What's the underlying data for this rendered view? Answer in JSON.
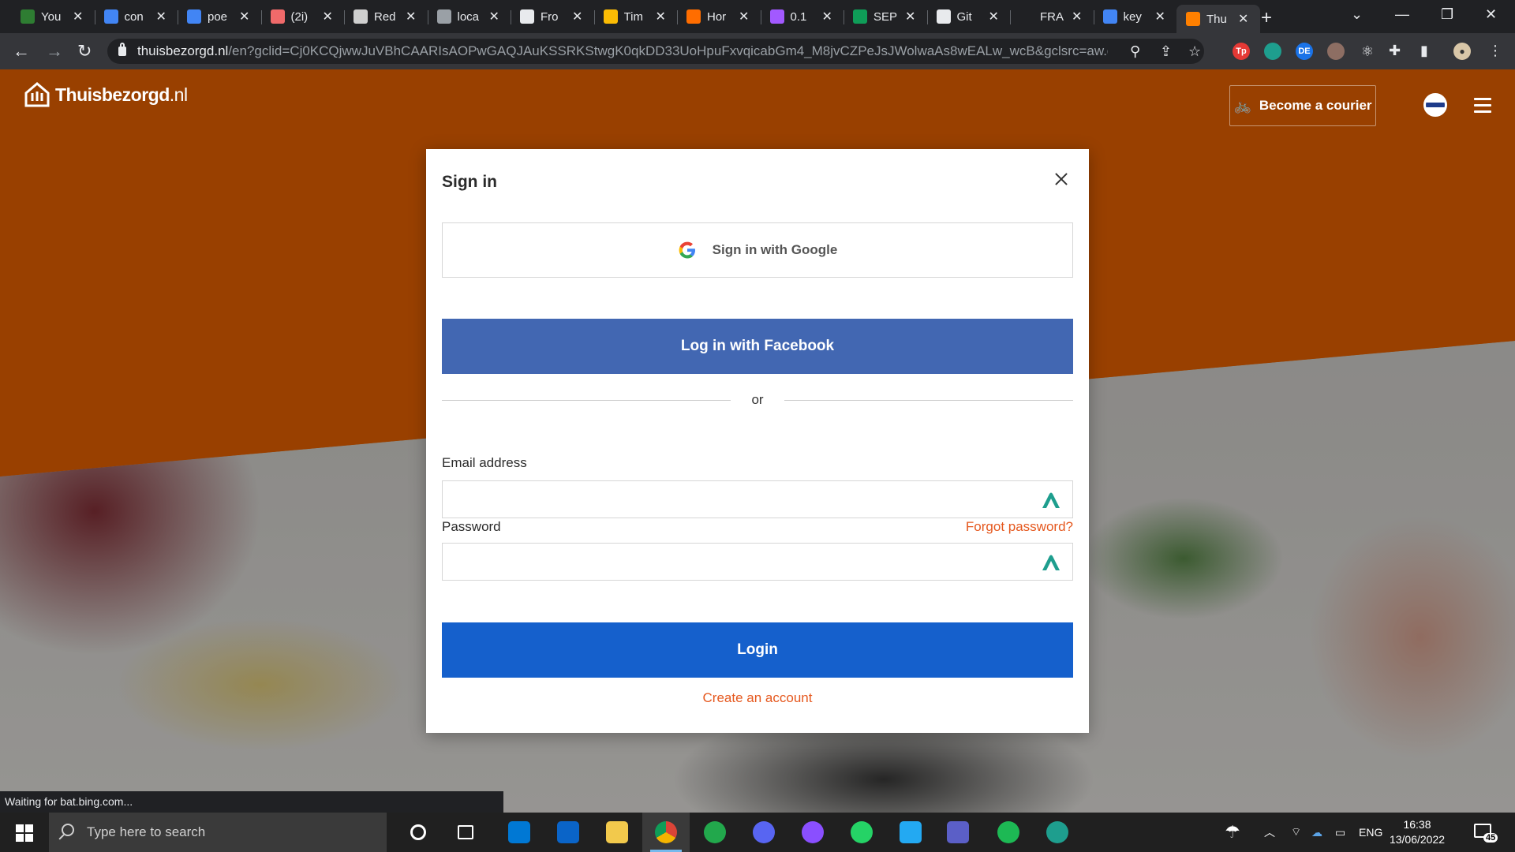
{
  "browser": {
    "tabs": [
      {
        "title": "You",
        "icon": "green-leaf-icon",
        "color": "#2e7d32"
      },
      {
        "title": "con",
        "icon": "google-icon",
        "color": "#4285f4"
      },
      {
        "title": "poe",
        "icon": "google-icon",
        "color": "#4285f4"
      },
      {
        "title": "(2i)",
        "icon": "asana-icon",
        "color": "#f06a6a"
      },
      {
        "title": "Red",
        "icon": "doc-icon",
        "color": "#cfcfcf"
      },
      {
        "title": "loca",
        "icon": "globe-icon",
        "color": "#9aa0a6"
      },
      {
        "title": "Fro",
        "icon": "github-icon",
        "color": "#e8eaed"
      },
      {
        "title": "Tim",
        "icon": "drive-icon",
        "color": "#fbbc04"
      },
      {
        "title": "Hor",
        "icon": "loader-icon",
        "color": "#ff6d00"
      },
      {
        "title": "0.1",
        "icon": "figma-icon",
        "color": "#a259ff"
      },
      {
        "title": "SEP",
        "icon": "sheets-icon",
        "color": "#0f9d58"
      },
      {
        "title": "Git",
        "icon": "github-icon",
        "color": "#e8eaed"
      },
      {
        "title": "FRA",
        "icon": "letter-f-icon",
        "color": "#202124"
      },
      {
        "title": "key",
        "icon": "google-icon",
        "color": "#4285f4"
      },
      {
        "title": "Thu",
        "icon": "thuisbezorgd-icon",
        "color": "#ff8000"
      }
    ],
    "active_tab_index": 14,
    "url_domain": "thuisbezorgd.nl",
    "url_path": "/en?gclid=Cj0KCQjwwJuVBhCAARIsAOPwGAQJAuKSSRKStwgK0qkDD33UoHpuFxvqicabGm4_M8jvCZPeJsJWolwaAs8wEALw_wcB&gclsrc=aw.ds",
    "extensions": [
      {
        "label": "Tp",
        "icon": "tp-extension-icon",
        "color": "#e53935"
      },
      {
        "label": "",
        "icon": "nordpass-icon",
        "color": "#1e9e8e"
      },
      {
        "label": "DE",
        "icon": "translate-extension-icon",
        "color": "#1a73e8"
      },
      {
        "label": "",
        "icon": "cookie-extension-icon",
        "color": "#8d6e63"
      },
      {
        "label": "",
        "icon": "react-devtools-icon",
        "color": "#e8eaed"
      }
    ],
    "status_text": "Waiting for bat.bing.com..."
  },
  "site": {
    "brand": "Thuisbezorgd",
    "brand_tld": ".nl",
    "courier_label": "Become a courier",
    "brand_color": "#994000"
  },
  "modal": {
    "title": "Sign in",
    "google_label": "Sign in with Google",
    "facebook_label": "Log in with Facebook",
    "divider_text": "or",
    "email_label": "Email address",
    "email_value": "",
    "password_label": "Password",
    "password_value": "",
    "forgot_label": "Forgot password?",
    "login_label": "Login",
    "create_label": "Create an account",
    "colors": {
      "facebook": "#4267b2",
      "login": "#1560cc",
      "link": "#e5581e"
    }
  },
  "taskbar": {
    "search_placeholder": "Type here to search",
    "apps": [
      {
        "name": "cortana-icon",
        "color": "#ffffff"
      },
      {
        "name": "task-view-icon",
        "color": "#ffffff"
      },
      {
        "name": "calendar-icon",
        "color": "#0078d4"
      },
      {
        "name": "outlook-icon",
        "color": "#0a64c8"
      },
      {
        "name": "file-explorer-icon",
        "color": "#f2c94c"
      },
      {
        "name": "chrome-icon",
        "color": "#db4437"
      },
      {
        "name": "circle-app-icon",
        "color": "#22a84c"
      },
      {
        "name": "discord-icon",
        "color": "#5865f2"
      },
      {
        "name": "github-desktop-icon",
        "color": "#8a4fff"
      },
      {
        "name": "whatsapp-icon",
        "color": "#25d366"
      },
      {
        "name": "vscode-icon",
        "color": "#23a9f2"
      },
      {
        "name": "teams-icon",
        "color": "#5b5fc7"
      },
      {
        "name": "spotify-icon",
        "color": "#1db954"
      },
      {
        "name": "nordpass-icon",
        "color": "#1e9e8e"
      }
    ],
    "language": "ENG",
    "time": "16:38",
    "date": "13/06/2022",
    "notification_count": "45"
  }
}
